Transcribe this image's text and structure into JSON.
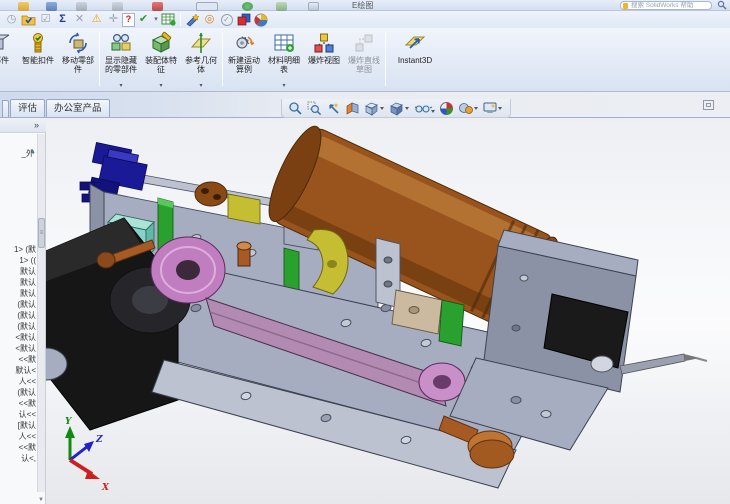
{
  "titlebar": {
    "title_fragment": "E绘图",
    "search_placeholder": "搜索 SolidWorks 帮助"
  },
  "toolbar2": {
    "items": [
      {
        "name": "history-icon",
        "glyph": "◷"
      },
      {
        "name": "design-binder-icon"
      },
      {
        "name": "select-checkbox-icon",
        "glyph": "☑"
      },
      {
        "name": "equations-icon",
        "glyph": "Σ"
      },
      {
        "name": "interference-icon",
        "glyph": "✕"
      },
      {
        "name": "warning-icon",
        "glyph": "⚠"
      },
      {
        "name": "align-icon",
        "glyph": "✛"
      },
      {
        "name": "help-doc-icon",
        "glyph": "?"
      },
      {
        "name": "verify-icon",
        "glyph": "✔"
      },
      {
        "name": "dropdown-icon",
        "glyph": "▾"
      },
      {
        "name": "bom-table-icon"
      },
      {
        "name": "photoview-icon"
      },
      {
        "name": "motion-rings-icon",
        "glyph": "◎"
      },
      {
        "name": "check-circle-icon",
        "glyph": "✓"
      },
      {
        "name": "simulation-boxes-icon"
      },
      {
        "name": "flow-sphere-icon"
      }
    ]
  },
  "command_manager": {
    "buttons": [
      {
        "id": "insert-component",
        "label": "零部件"
      },
      {
        "id": "smart-fasteners",
        "label": "智能扣件"
      },
      {
        "id": "move-component",
        "label": "移动零部件"
      },
      {
        "id": "show-hidden-components",
        "label": "显示隐藏的零部件",
        "flyout": "▾"
      },
      {
        "id": "assembly-features",
        "label": "装配体特征",
        "flyout": "▾"
      },
      {
        "id": "reference-geometry",
        "label": "参考几何体",
        "flyout": "▾"
      },
      {
        "id": "new-motion-study",
        "label": "新建运动算例"
      },
      {
        "id": "bill-of-materials",
        "label": "材料明细表",
        "flyout": "▾"
      },
      {
        "id": "exploded-view",
        "label": "爆炸视图"
      },
      {
        "id": "explode-line-sketch",
        "label": "爆炸直线草图"
      },
      {
        "id": "instant3d",
        "label": "Instant3D"
      }
    ]
  },
  "tabs": {
    "items": [
      {
        "label": "评估"
      },
      {
        "label": "办公室产品"
      }
    ]
  },
  "feature_tree": {
    "header_chevron": "»",
    "top_item": "_外",
    "scroll_up": "▲",
    "scroll_down": "▼",
    "items": [
      "1> (默",
      "1> ((",
      "默认",
      "默认",
      "默认",
      "(默认",
      "(默认",
      "(默认",
      "<默认",
      "<默认",
      "<<默",
      "默认<",
      "人<<",
      "(默认",
      "<<默",
      "认<<",
      "[默认",
      "人<<",
      "<<默",
      "认<,"
    ]
  },
  "viewport": {
    "heads_up_icons": [
      "zoom-fit",
      "zoom-area",
      "previous-view",
      "section-view",
      "view-orientation",
      "display-style",
      "hide-show-items",
      "edit-appearance",
      "apply-scene",
      "view-settings"
    ],
    "triad": {
      "x_label": "X",
      "y_label": "Y",
      "z_label": "Z",
      "x_color": "#cc2020",
      "y_color": "#108a10",
      "z_color": "#2020cc"
    }
  },
  "model": {
    "colors": {
      "frame_gray": "#a6adc0",
      "frame_dark": "#8b92a6",
      "frame_light": "#bcc2d0",
      "motor_brown": "#99541d",
      "motor_dark": "#6f3a10",
      "motor_light": "#bf7a35",
      "bracket_blue": "#1a1a96",
      "block_cyan": "#86d2c6",
      "plate_green": "#2aa12e",
      "part_yellow": "#c5bd32",
      "pulley_magenta": "#c07ec0",
      "belt_pink": "#b28ab2",
      "plate_black": "#161616",
      "bolt_copper": "#a85a24",
      "block_tan": "#cbb9a0"
    }
  }
}
